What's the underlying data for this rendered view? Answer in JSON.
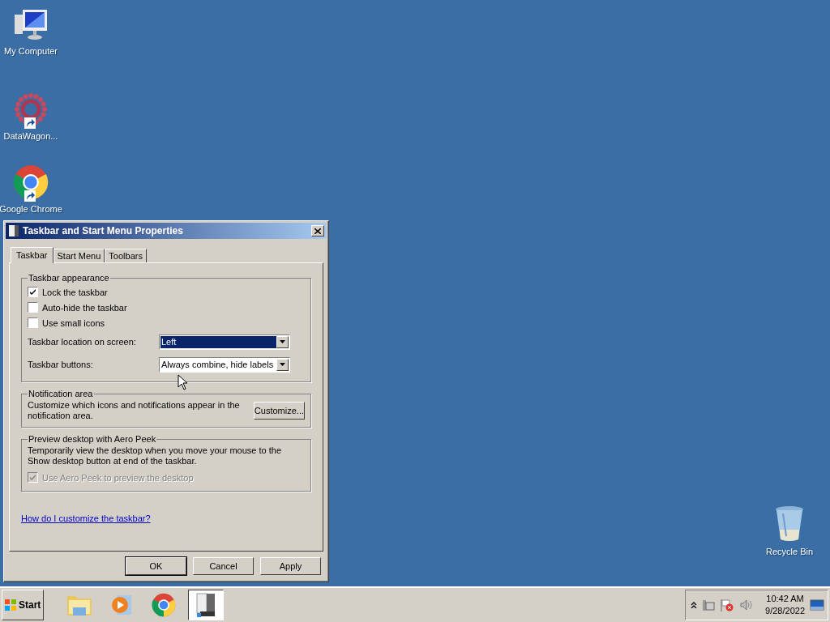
{
  "desktop_icons": [
    {
      "label": "My Computer",
      "kind": "computer",
      "shortcut": false
    },
    {
      "label": "DataWagon...",
      "kind": "burst",
      "shortcut": true
    },
    {
      "label": "Google Chrome",
      "kind": "chrome",
      "shortcut": true
    },
    {
      "label": "Recycle Bin",
      "kind": "bin",
      "shortcut": false
    }
  ],
  "dialog": {
    "title": "Taskbar and Start Menu Properties",
    "tabs": [
      {
        "label": "Taskbar",
        "selected": true
      },
      {
        "label": "Start Menu",
        "selected": false
      },
      {
        "label": "Toolbars",
        "selected": false
      }
    ],
    "appearance": {
      "legend": "Taskbar appearance",
      "checkboxes": [
        {
          "label": "Lock the taskbar",
          "checked": true
        },
        {
          "label": "Auto-hide the taskbar",
          "checked": false
        },
        {
          "label": "Use small icons",
          "checked": false
        }
      ],
      "dropdowns": [
        {
          "label": "Taskbar location on screen:",
          "value": "Left",
          "focused": true
        },
        {
          "label": "Taskbar buttons:",
          "value": "Always combine, hide labels",
          "focused": false
        }
      ]
    },
    "notification": {
      "legend": "Notification area",
      "text": "Customize which icons and notifications appear in the notification area.",
      "button": "Customize..."
    },
    "peek": {
      "legend": "Preview desktop with Aero Peek",
      "text": "Temporarily view the desktop when you move your mouse to the Show desktop button at end of the taskbar.",
      "checkbox": {
        "label": "Use Aero Peek to preview the desktop",
        "checked": true,
        "disabled": true
      }
    },
    "help_link": "How do I customize the taskbar?",
    "buttons": [
      {
        "label": "OK",
        "default": true
      },
      {
        "label": "Cancel",
        "default": false
      },
      {
        "label": "Apply",
        "default": false
      }
    ]
  },
  "taskbar": {
    "start": "Start",
    "pinned": [
      {
        "kind": "folder",
        "selected": false
      },
      {
        "kind": "media",
        "selected": false
      },
      {
        "kind": "chrome",
        "selected": false
      },
      {
        "kind": "server",
        "selected": true
      }
    ],
    "tray": {
      "time": "10:42 AM",
      "date": "9/28/2022"
    }
  }
}
